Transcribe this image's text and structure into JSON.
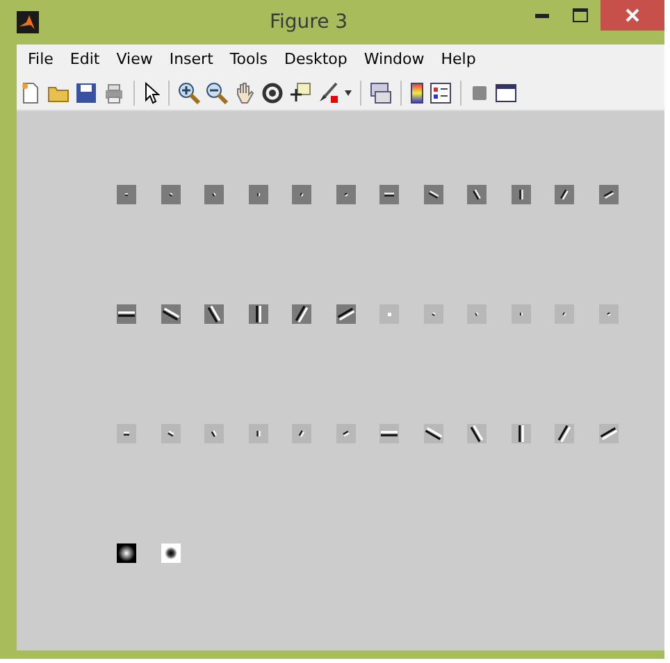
{
  "window": {
    "title": "Figure 3"
  },
  "menu": [
    "File",
    "Edit",
    "View",
    "Insert",
    "Tools",
    "Desktop",
    "Window",
    "Help"
  ],
  "axes_grid": {
    "rows": [
      [
        {
          "kind": "dash"
        },
        {
          "kind": "dash"
        },
        {
          "kind": "dash"
        },
        {
          "kind": "dash"
        },
        {
          "kind": "dash"
        },
        {
          "kind": "dash"
        },
        {
          "kind": "stroke"
        },
        {
          "kind": "stroke"
        },
        {
          "kind": "stroke"
        },
        {
          "kind": "stroke"
        },
        {
          "kind": "stroke"
        },
        {
          "kind": "stroke"
        }
      ],
      [
        {
          "kind": "band"
        },
        {
          "kind": "band"
        },
        {
          "kind": "band"
        },
        {
          "kind": "band"
        },
        {
          "kind": "band"
        },
        {
          "kind": "band"
        },
        {
          "kind": "spot"
        },
        {
          "kind": "dot"
        },
        {
          "kind": "dot"
        },
        {
          "kind": "dot"
        },
        {
          "kind": "dot"
        },
        {
          "kind": "dot"
        }
      ],
      [
        {
          "kind": "hatch"
        },
        {
          "kind": "hatch"
        },
        {
          "kind": "hatch"
        },
        {
          "kind": "hatch"
        },
        {
          "kind": "hatch"
        },
        {
          "kind": "hatch"
        },
        {
          "kind": "streak"
        },
        {
          "kind": "streak"
        },
        {
          "kind": "streak"
        },
        {
          "kind": "streak"
        },
        {
          "kind": "streak"
        },
        {
          "kind": "streak"
        }
      ],
      [
        {
          "kind": "gaussian"
        },
        {
          "kind": "log"
        }
      ]
    ]
  }
}
